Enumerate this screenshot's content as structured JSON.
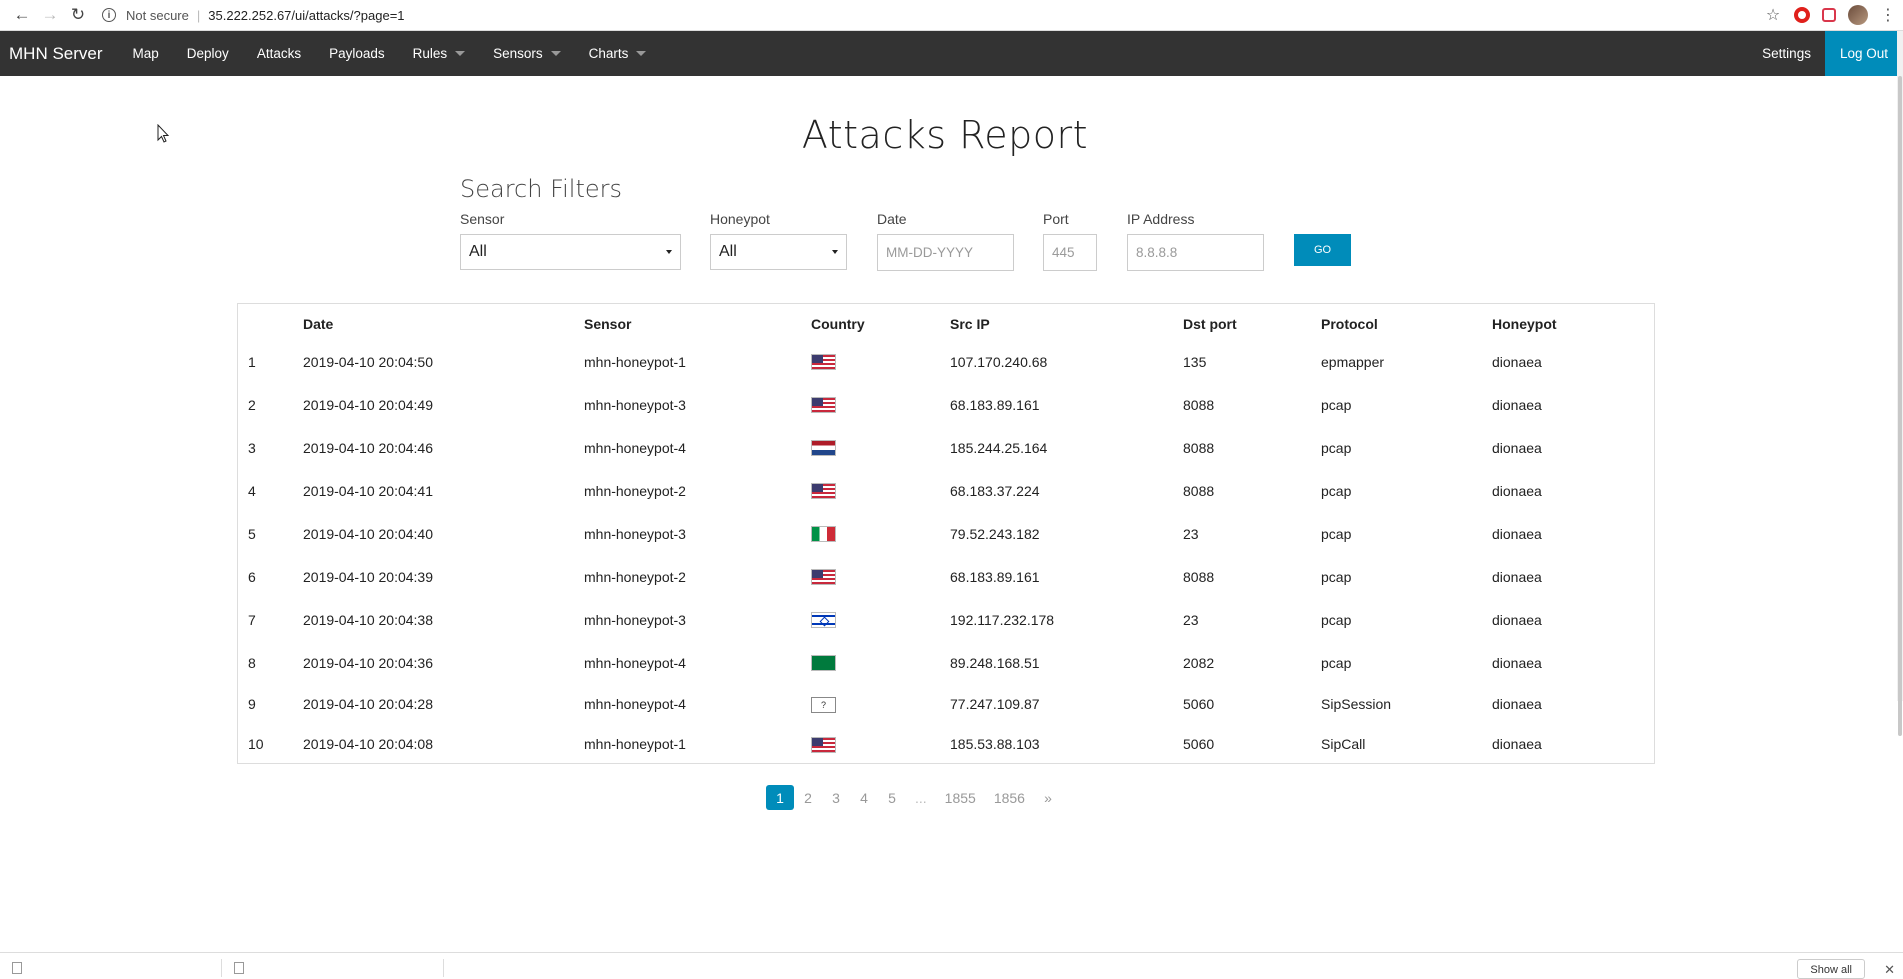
{
  "browser": {
    "security_label": "Not secure",
    "url": "35.222.252.67/ui/attacks/?page=1"
  },
  "navbar": {
    "brand": "MHN Server",
    "items": [
      "Map",
      "Deploy",
      "Attacks",
      "Payloads",
      "Rules",
      "Sensors",
      "Charts"
    ],
    "settings": "Settings",
    "logout": "Log Out"
  },
  "page": {
    "title": "Attacks Report"
  },
  "filters": {
    "title": "Search Filters",
    "sensor": {
      "label": "Sensor",
      "value": "All"
    },
    "honeypot": {
      "label": "Honeypot",
      "value": "All"
    },
    "date": {
      "label": "Date",
      "placeholder": "MM-DD-YYYY"
    },
    "port": {
      "label": "Port",
      "placeholder": "445"
    },
    "ip": {
      "label": "IP Address",
      "placeholder": "8.8.8.8"
    },
    "go": "GO"
  },
  "table": {
    "headers": [
      "",
      "Date",
      "Sensor",
      "Country",
      "Src IP",
      "Dst port",
      "Protocol",
      "Honeypot"
    ],
    "rows": [
      {
        "n": "1",
        "date": "2019-04-10 20:04:50",
        "sensor": "mhn-honeypot-1",
        "flag": "us",
        "src": "107.170.240.68",
        "port": "135",
        "proto": "epmapper",
        "hp": "dionaea"
      },
      {
        "n": "2",
        "date": "2019-04-10 20:04:49",
        "sensor": "mhn-honeypot-3",
        "flag": "us",
        "src": "68.183.89.161",
        "port": "8088",
        "proto": "pcap",
        "hp": "dionaea"
      },
      {
        "n": "3",
        "date": "2019-04-10 20:04:46",
        "sensor": "mhn-honeypot-4",
        "flag": "nl",
        "src": "185.244.25.164",
        "port": "8088",
        "proto": "pcap",
        "hp": "dionaea"
      },
      {
        "n": "4",
        "date": "2019-04-10 20:04:41",
        "sensor": "mhn-honeypot-2",
        "flag": "us",
        "src": "68.183.37.224",
        "port": "8088",
        "proto": "pcap",
        "hp": "dionaea"
      },
      {
        "n": "5",
        "date": "2019-04-10 20:04:40",
        "sensor": "mhn-honeypot-3",
        "flag": "it",
        "src": "79.52.243.182",
        "port": "23",
        "proto": "pcap",
        "hp": "dionaea"
      },
      {
        "n": "6",
        "date": "2019-04-10 20:04:39",
        "sensor": "mhn-honeypot-2",
        "flag": "us",
        "src": "68.183.89.161",
        "port": "8088",
        "proto": "pcap",
        "hp": "dionaea"
      },
      {
        "n": "7",
        "date": "2019-04-10 20:04:38",
        "sensor": "mhn-honeypot-3",
        "flag": "il",
        "src": "192.117.232.178",
        "port": "23",
        "proto": "pcap",
        "hp": "dionaea"
      },
      {
        "n": "8",
        "date": "2019-04-10 20:04:36",
        "sensor": "mhn-honeypot-4",
        "flag": "sc",
        "src": "89.248.168.51",
        "port": "2082",
        "proto": "pcap",
        "hp": "dionaea"
      },
      {
        "n": "9",
        "date": "2019-04-10 20:04:28",
        "sensor": "mhn-honeypot-4",
        "flag": "unk",
        "src": "77.247.109.87",
        "port": "5060",
        "proto": "SipSession",
        "hp": "dionaea"
      },
      {
        "n": "10",
        "date": "2019-04-10 20:04:08",
        "sensor": "mhn-honeypot-1",
        "flag": "us",
        "src": "185.53.88.103",
        "port": "5060",
        "proto": "SipCall",
        "hp": "dionaea"
      }
    ]
  },
  "pagination": {
    "pages": [
      "1",
      "2",
      "3",
      "4",
      "5",
      "...",
      "1855",
      "1856",
      "»"
    ],
    "active": "1"
  },
  "downloads": {
    "show_all": "Show all"
  },
  "colors": {
    "navbar_bg": "#333333",
    "accent": "#008cba"
  }
}
